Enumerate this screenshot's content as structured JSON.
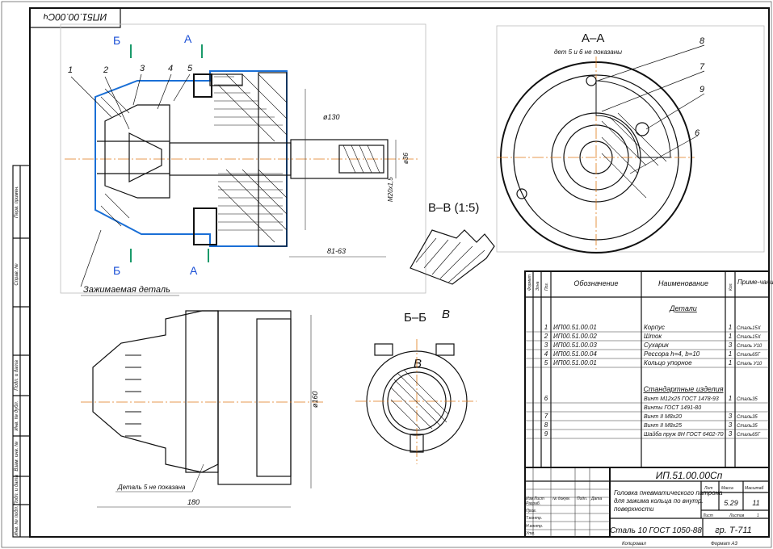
{
  "stamp_top": "ИП51.00.00Сч",
  "section_labels": {
    "aa": "А–А",
    "aa_note": "дет 5 и 6 не показаны",
    "bb": "Б–Б",
    "vv": "В–В (1:5)",
    "b": "Б",
    "a": "А",
    "v": "В"
  },
  "leaders": [
    "1",
    "2",
    "3",
    "4",
    "5",
    "8",
    "7",
    "9",
    "6"
  ],
  "notes": {
    "clamped_part": "Зажимаемая деталь",
    "part5_hidden": "Деталь 5 не показана"
  },
  "dimensions": {
    "d130": "ø130",
    "d36": "ø36",
    "m20": "M20x1,5",
    "len_81": "81-63",
    "d160": "ø160",
    "len_180": "180"
  },
  "spec_header": {
    "format": "Формат",
    "zone": "Зона",
    "pos": "Поз.",
    "designation": "Обозначение",
    "name": "Наименование",
    "qty": "Кол.",
    "note": "Приме-чание"
  },
  "spec_sections": {
    "parts": "Детали",
    "standard": "Стандартные изделия"
  },
  "spec_parts": [
    {
      "pos": "1",
      "des": "ИП00.51.00.01",
      "name": "Корпус",
      "qty": "1",
      "note": "Сталь15Х"
    },
    {
      "pos": "2",
      "des": "ИП00.51.00.02",
      "name": "Шток",
      "qty": "1",
      "note": "Сталь15Х"
    },
    {
      "pos": "3",
      "des": "ИП00.51.00.03",
      "name": "Сухарик",
      "qty": "3",
      "note": "Сталь У10"
    },
    {
      "pos": "4",
      "des": "ИП00.51.00.04",
      "name": "Рессора h=4, b=10",
      "qty": "1",
      "note": "Сталь65Г"
    },
    {
      "pos": "5",
      "des": "ИП00.51.00.01",
      "name": "Кольцо упорное",
      "qty": "1",
      "note": "Сталь У10"
    }
  ],
  "spec_standard": [
    {
      "pos": "6",
      "name": "Винт М12х25 ГОСТ 1478-93",
      "qty": "1",
      "note": "Сталь35"
    },
    {
      "pos": "",
      "name": "Винты ГОСТ 1491-80",
      "qty": "",
      "note": ""
    },
    {
      "pos": "7",
      "name": "Винт II М8х20",
      "qty": "3",
      "note": "Сталь35"
    },
    {
      "pos": "8",
      "name": "Винт II М8х25",
      "qty": "3",
      "note": "Сталь35"
    },
    {
      "pos": "9",
      "name": "Шайба пруж 8Н ГОСТ 6402-70",
      "qty": "3",
      "note": "Сталь65Г"
    }
  ],
  "title_block": {
    "code": "ИП.51.00.00Сп",
    "title": "Головка пневматического патрона для зажима кольца по внутр. поверхности",
    "material": "Сталь 10 ГОСТ 1050-88",
    "group": "гр. Т-711",
    "mass_label": "Масса",
    "scale_label": "Масштаб",
    "lit_label": "Лит",
    "mass": "5.29",
    "scale": "11",
    "sheet_label": "Лист",
    "sheets_label": "Листов",
    "sheets": "1",
    "roles": [
      "Изм",
      "Лист",
      "№ докум.",
      "Подп.",
      "Дата",
      "Разраб.",
      "Пров.",
      "Т.контр.",
      "Н.контр.",
      "Утв."
    ],
    "copied": "Копировал",
    "format": "Формат А3"
  },
  "side_strip": [
    "Перв. примен.",
    "Справ. №",
    "Подп. и дата",
    "Инв. № дубл.",
    "Взам. инв. №",
    "Подп. и дата",
    "Инв. № подл."
  ]
}
